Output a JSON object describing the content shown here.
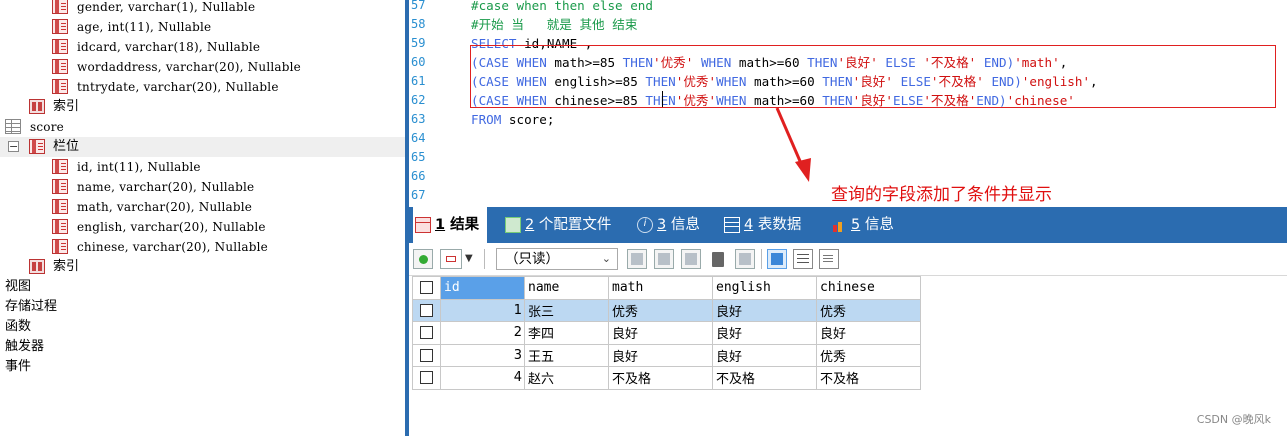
{
  "tree": {
    "rows": [
      {
        "text": "gender, varchar(1), Nullable",
        "icon": "column-icon"
      },
      {
        "text": "age, int(11), Nullable",
        "icon": "column-icon"
      },
      {
        "text": "idcard, varchar(18), Nullable",
        "icon": "column-icon"
      },
      {
        "text": "wordaddress, varchar(20), Nullable",
        "icon": "column-icon"
      },
      {
        "text": "tntrydate, varchar(20), Nullable",
        "icon": "column-icon"
      },
      {
        "text": "索引",
        "icon": "index-icon"
      },
      {
        "text": "score",
        "icon": "table-icon"
      },
      {
        "text": "栏位",
        "icon": "column-icon"
      },
      {
        "text": "id, int(11), Nullable",
        "icon": "column-icon"
      },
      {
        "text": "name, varchar(20), Nullable",
        "icon": "column-icon"
      },
      {
        "text": "math, varchar(20), Nullable",
        "icon": "column-icon"
      },
      {
        "text": "english, varchar(20), Nullable",
        "icon": "column-icon"
      },
      {
        "text": "chinese, varchar(20), Nullable",
        "icon": "column-icon"
      },
      {
        "text": "索引",
        "icon": "index-icon"
      },
      {
        "text": "视图"
      },
      {
        "text": "存储过程"
      },
      {
        "text": "函数"
      },
      {
        "text": "触发器"
      },
      {
        "text": "事件"
      }
    ]
  },
  "editor": {
    "line_numbers": [
      "57",
      "58",
      "59",
      "60",
      "61",
      "62",
      "63",
      "64",
      "65",
      "66",
      "67"
    ],
    "lines": {
      "l57": "#case when then else end",
      "l58": "#开始 当   就是 其他 结束",
      "l59_kw": "SELECT",
      "l59_rest": " id,NAME ,",
      "l60": {
        "a": "(CASE WHEN",
        "b": " math>=85 ",
        "c": "THEN",
        "d": "'优秀'",
        "e": " WHEN",
        "f": " math>=60 ",
        "g": "THEN",
        "h": "'良好'",
        "i": " ELSE ",
        "j": "'不及格'",
        "k": " END)",
        "l": "'math'",
        "m": ","
      },
      "l61": {
        "a": "(CASE WHEN",
        "b": " english>=85 ",
        "c": "THEN",
        "d": "'优秀'",
        "e": "WHEN",
        "f": " math>=60 ",
        "g": "THEN",
        "h": "'良好'",
        "i": " ELSE",
        "j": "'不及格'",
        "k": " END)",
        "l": "'english'",
        "m": ","
      },
      "l62": {
        "a": "(CASE WHEN",
        "b": " chinese>=85 ",
        "c": "THEN",
        "d": "'优秀'",
        "e": "WHEN",
        "f": " math>=60 ",
        "g": "THEN",
        "h": "'良好'",
        "i": "ELSE",
        "j": "'不及格'",
        "k": "END)",
        "l": "'chinese'"
      },
      "l63_kw": "FROM",
      "l63_rest": " score;"
    },
    "annotation": "查询的字段添加了条件并显示",
    "highlight_color": "#e02020"
  },
  "tabs": [
    {
      "num": "1",
      "label": "结果",
      "icon": "result-grid-icon"
    },
    {
      "num": "2",
      "label": "个配置文件",
      "icon": "profile-icon"
    },
    {
      "num": "3",
      "label": "信息",
      "icon": "info-icon"
    },
    {
      "num": "4",
      "label": "表数据",
      "icon": "table-data-icon"
    },
    {
      "num": "5",
      "label": "信息",
      "icon": "info-chart-icon"
    }
  ],
  "toolbar": {
    "mode": "（只读）"
  },
  "grid": {
    "columns": [
      "id",
      "name",
      "math",
      "english",
      "chinese"
    ],
    "rows": [
      {
        "id": "1",
        "name": "张三",
        "math": "优秀",
        "english": "良好",
        "chinese": "优秀"
      },
      {
        "id": "2",
        "name": "李四",
        "math": "良好",
        "english": "良好",
        "chinese": "良好"
      },
      {
        "id": "3",
        "name": "王五",
        "math": "良好",
        "english": "良好",
        "chinese": "优秀"
      },
      {
        "id": "4",
        "name": "赵六",
        "math": "不及格",
        "english": "不及格",
        "chinese": "不及格"
      }
    ]
  },
  "footer": "CSDN @晚风k",
  "colors": {
    "accent": "#2b6cb0",
    "keyword": "#4169e1",
    "comment": "#1a9a4a",
    "string": "#d01010",
    "selected_row": "#bcd8f2"
  }
}
